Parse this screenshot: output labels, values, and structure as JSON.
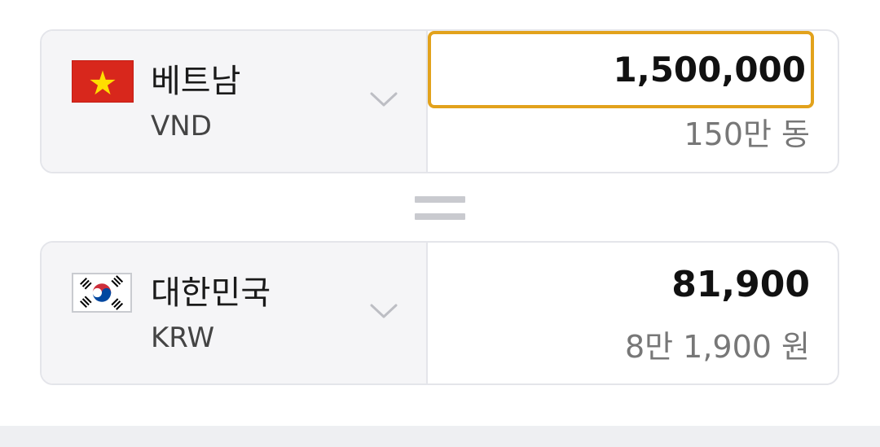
{
  "converter": {
    "from": {
      "country": "베트남",
      "code": "VND",
      "flag_icon": "vietnam-flag",
      "amount": "1,500,000",
      "amount_readable": "150만 동"
    },
    "to": {
      "country": "대한민국",
      "code": "KRW",
      "flag_icon": "south-korea-flag",
      "amount": "81,900",
      "amount_readable": "8만 1,900 원"
    },
    "equals_icon": "equals-icon"
  },
  "colors": {
    "input_border": "#e2a21c",
    "selector_bg": "#f5f5f7",
    "vn_flag_red": "#d8271c",
    "vn_flag_star": "#ffde00",
    "kr_flag_red": "#cd2e3a",
    "kr_flag_blue": "#0047a0"
  }
}
